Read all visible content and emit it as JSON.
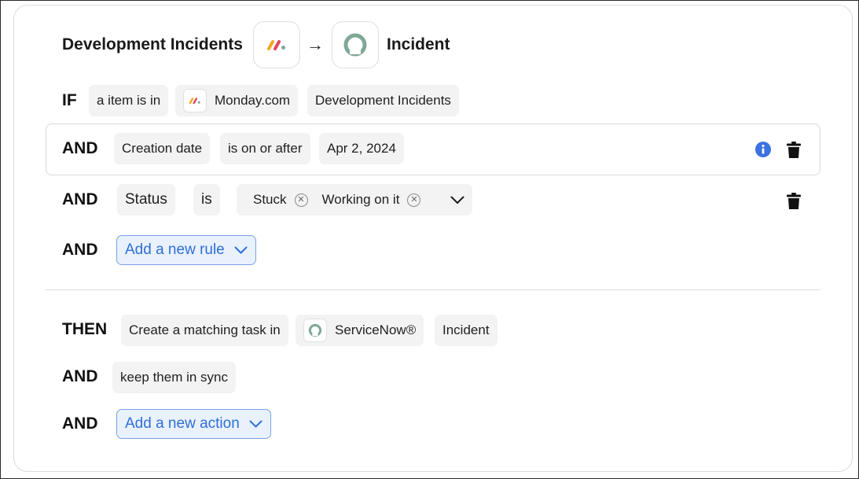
{
  "header": {
    "source_title": "Development Incidents",
    "source_logo_icon": "monday-logo-icon",
    "arrow": "→",
    "target_logo_icon": "servicenow-logo-icon",
    "target_title": "Incident"
  },
  "if_row": {
    "keyword": "IF",
    "condition": "a item is in",
    "app": "Monday.com",
    "board": "Development Incidents"
  },
  "rule_1": {
    "keyword": "AND",
    "field": "Creation date",
    "operator": "is on or after",
    "value": "Apr 2, 2024",
    "info_icon": "info-icon",
    "delete_icon": "trash-icon"
  },
  "rule_2": {
    "keyword": "AND",
    "field": "Status",
    "operator": "is",
    "values": [
      "Stuck",
      "Working on it"
    ],
    "delete_icon": "trash-icon"
  },
  "rule_add": {
    "keyword": "AND",
    "label": "Add a new rule"
  },
  "then_row": {
    "keyword": "THEN",
    "action": "Create a matching task in",
    "app": "ServiceNow®",
    "target": "Incident"
  },
  "sync_row": {
    "keyword": "AND",
    "label": "keep them in sync"
  },
  "action_add": {
    "keyword": "AND",
    "label": "Add a new action"
  },
  "colors": {
    "accent_blue": "#2f6fd6",
    "info_blue": "#3b73e0",
    "servicenow_green": "#7fa896"
  }
}
